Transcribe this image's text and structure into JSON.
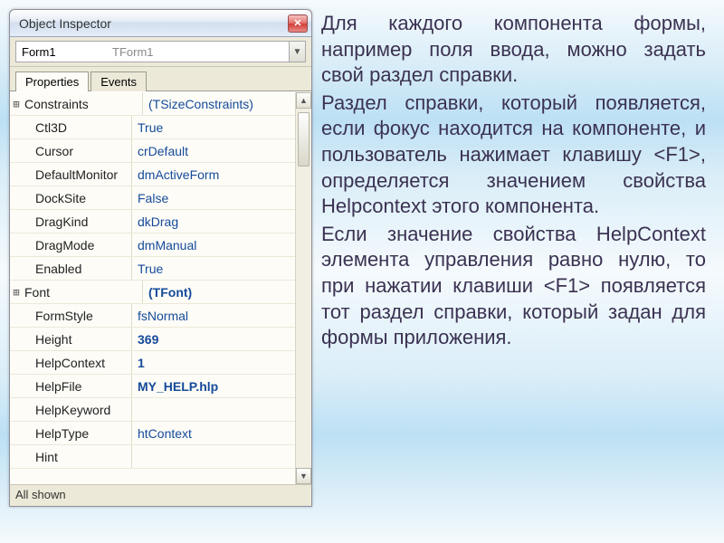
{
  "window": {
    "title": "Object Inspector"
  },
  "combo": {
    "name": "Form1",
    "type": "TForm1"
  },
  "tabs": {
    "properties": "Properties",
    "events": "Events"
  },
  "properties": [
    {
      "glyph": "⊞",
      "name": "Constraints",
      "value": "(TSizeConstraints)",
      "bold": false
    },
    {
      "glyph": "",
      "name": "Ctl3D",
      "value": "True",
      "bold": false,
      "indent": true
    },
    {
      "glyph": "",
      "name": "Cursor",
      "value": "crDefault",
      "bold": false,
      "indent": true
    },
    {
      "glyph": "",
      "name": "DefaultMonitor",
      "value": "dmActiveForm",
      "bold": false,
      "indent": true
    },
    {
      "glyph": "",
      "name": "DockSite",
      "value": "False",
      "bold": false,
      "indent": true
    },
    {
      "glyph": "",
      "name": "DragKind",
      "value": "dkDrag",
      "bold": false,
      "indent": true
    },
    {
      "glyph": "",
      "name": "DragMode",
      "value": "dmManual",
      "bold": false,
      "indent": true
    },
    {
      "glyph": "",
      "name": "Enabled",
      "value": "True",
      "bold": false,
      "indent": true
    },
    {
      "glyph": "⊞",
      "name": "Font",
      "value": "(TFont)",
      "bold": true
    },
    {
      "glyph": "",
      "name": "FormStyle",
      "value": "fsNormal",
      "bold": false,
      "indent": true
    },
    {
      "glyph": "",
      "name": "Height",
      "value": "369",
      "bold": true,
      "indent": true
    },
    {
      "glyph": "",
      "name": "HelpContext",
      "value": "1",
      "bold": true,
      "indent": true
    },
    {
      "glyph": "",
      "name": "HelpFile",
      "value": "MY_HELP.hlp",
      "bold": true,
      "indent": true
    },
    {
      "glyph": "",
      "name": "HelpKeyword",
      "value": "",
      "bold": false,
      "indent": true
    },
    {
      "glyph": "",
      "name": "HelpType",
      "value": "htContext",
      "bold": false,
      "indent": true
    },
    {
      "glyph": "",
      "name": "Hint",
      "value": "",
      "bold": false,
      "indent": true
    }
  ],
  "status": "All shown",
  "description": {
    "p1": "Для каждого компонента формы, например поля ввода, можно задать свой раздел справки.",
    "p2": "Раздел справки, который появляется, если фокус находится на компоненте, и пользователь нажимает клавишу <F1>, определяется значением свойства Helpcontext этого компонента.",
    "p3": "Если значение свойства HelpContext элемента управления равно нулю, то при нажатии клавиши <F1> появляется тот раздел справки, который задан для формы приложения."
  }
}
